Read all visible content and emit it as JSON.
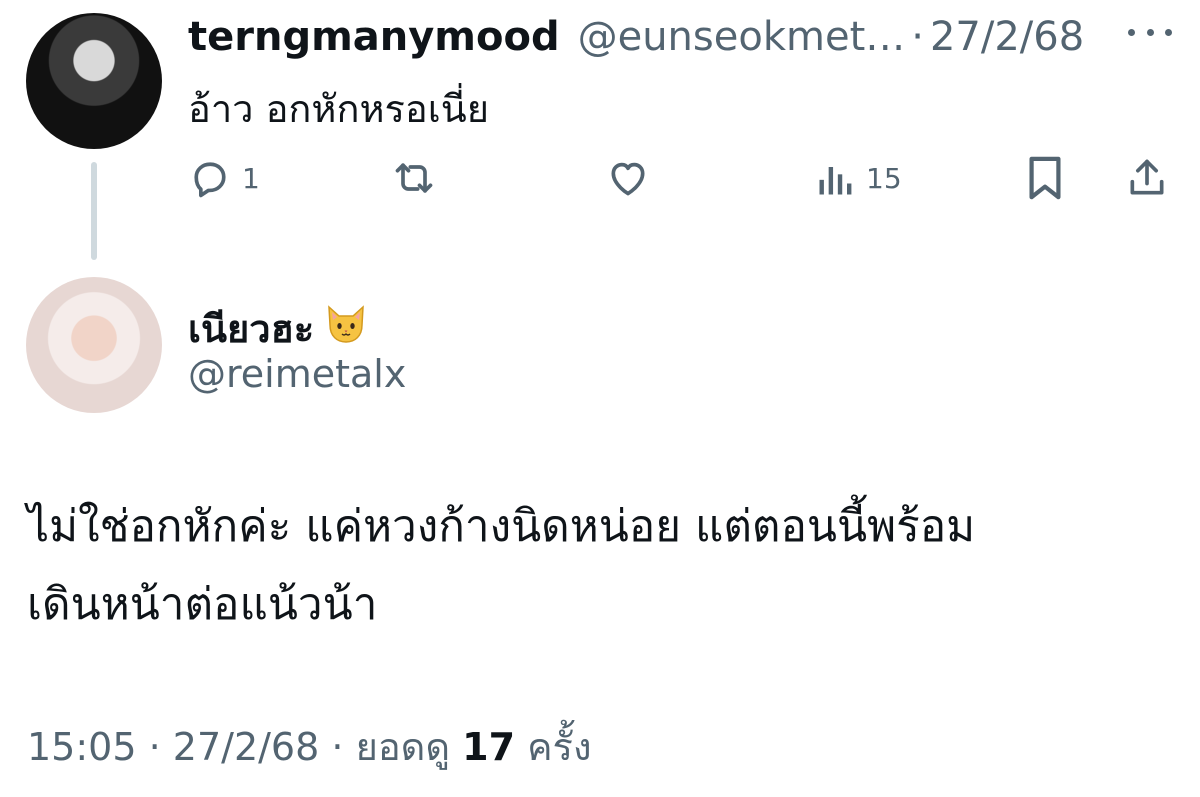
{
  "reply_to_tweet": {
    "display_name": "terngmanymood",
    "handle": "@eunseokmet…",
    "separator": "·",
    "date": "27/2/68",
    "text": "อ้าว อกหักหรอเนี่ย",
    "more_icon": "ellipsis-icon",
    "actions": {
      "reply_icon": "comment-icon",
      "reply_count": "1",
      "retweet_icon": "retweet-icon",
      "like_icon": "heart-icon",
      "views_icon": "analytics-bars-icon",
      "views_count": "15",
      "bookmark_icon": "bookmark-icon",
      "share_icon": "share-icon"
    }
  },
  "main_tweet": {
    "display_name": "เนียวฮะ",
    "name_emoji": "cat-face-icon",
    "handle": "@reimetalx",
    "text_line_1": "ไม่ใช่อกหักค่ะ แค่หวงก้างนิดหน่อย แต่ตอนนี้พร้อม",
    "text_line_2": "เดินหน้าต่อแน้วน้า",
    "meta": {
      "time": "15:05",
      "separator": "·",
      "date": "27/2/68",
      "views_label": "ยอดดู",
      "views_count": "17",
      "views_unit": "ครั้ง"
    }
  },
  "colors": {
    "primary_text": "#0f1419",
    "secondary_text": "#536471",
    "thread_line": "#cfd9de",
    "background": "#ffffff"
  }
}
